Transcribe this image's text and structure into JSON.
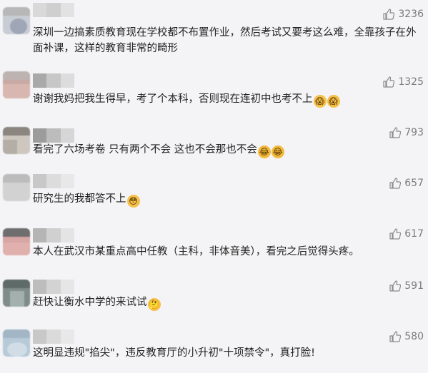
{
  "comments": [
    {
      "likes": "3236",
      "text": "深圳一边搞素质教育现在学校都不布置作业，然后考试又要考这么难，全靠孩子在外面补课，这样的教育非常的畸形",
      "emoji": []
    },
    {
      "likes": "1325",
      "text": "谢谢我妈把我生得早，考了个本科，否则现在连初中也考不上",
      "emoji": [
        "scream",
        "scream"
      ]
    },
    {
      "likes": "793",
      "text": "看完了六场考卷 只有两个不会 这也不会那也不会",
      "emoji": [
        "laugh-cry",
        "laugh-cry"
      ]
    },
    {
      "likes": "657",
      "text": "研究生的我都答不上",
      "emoji": [
        "flushed"
      ]
    },
    {
      "likes": "617",
      "text": "本人在武汉市某重点高中任教（主科，非体音美），看完之后觉得头疼。",
      "emoji": []
    },
    {
      "likes": "591",
      "text": "赶快让衡水中学的来试试",
      "emoji": [
        "thinking"
      ]
    },
    {
      "likes": "580",
      "text": "这明显违规\"掐尖\"，违反教育厅的小升初\"十项禁令\"，真打脸!",
      "emoji": []
    }
  ]
}
